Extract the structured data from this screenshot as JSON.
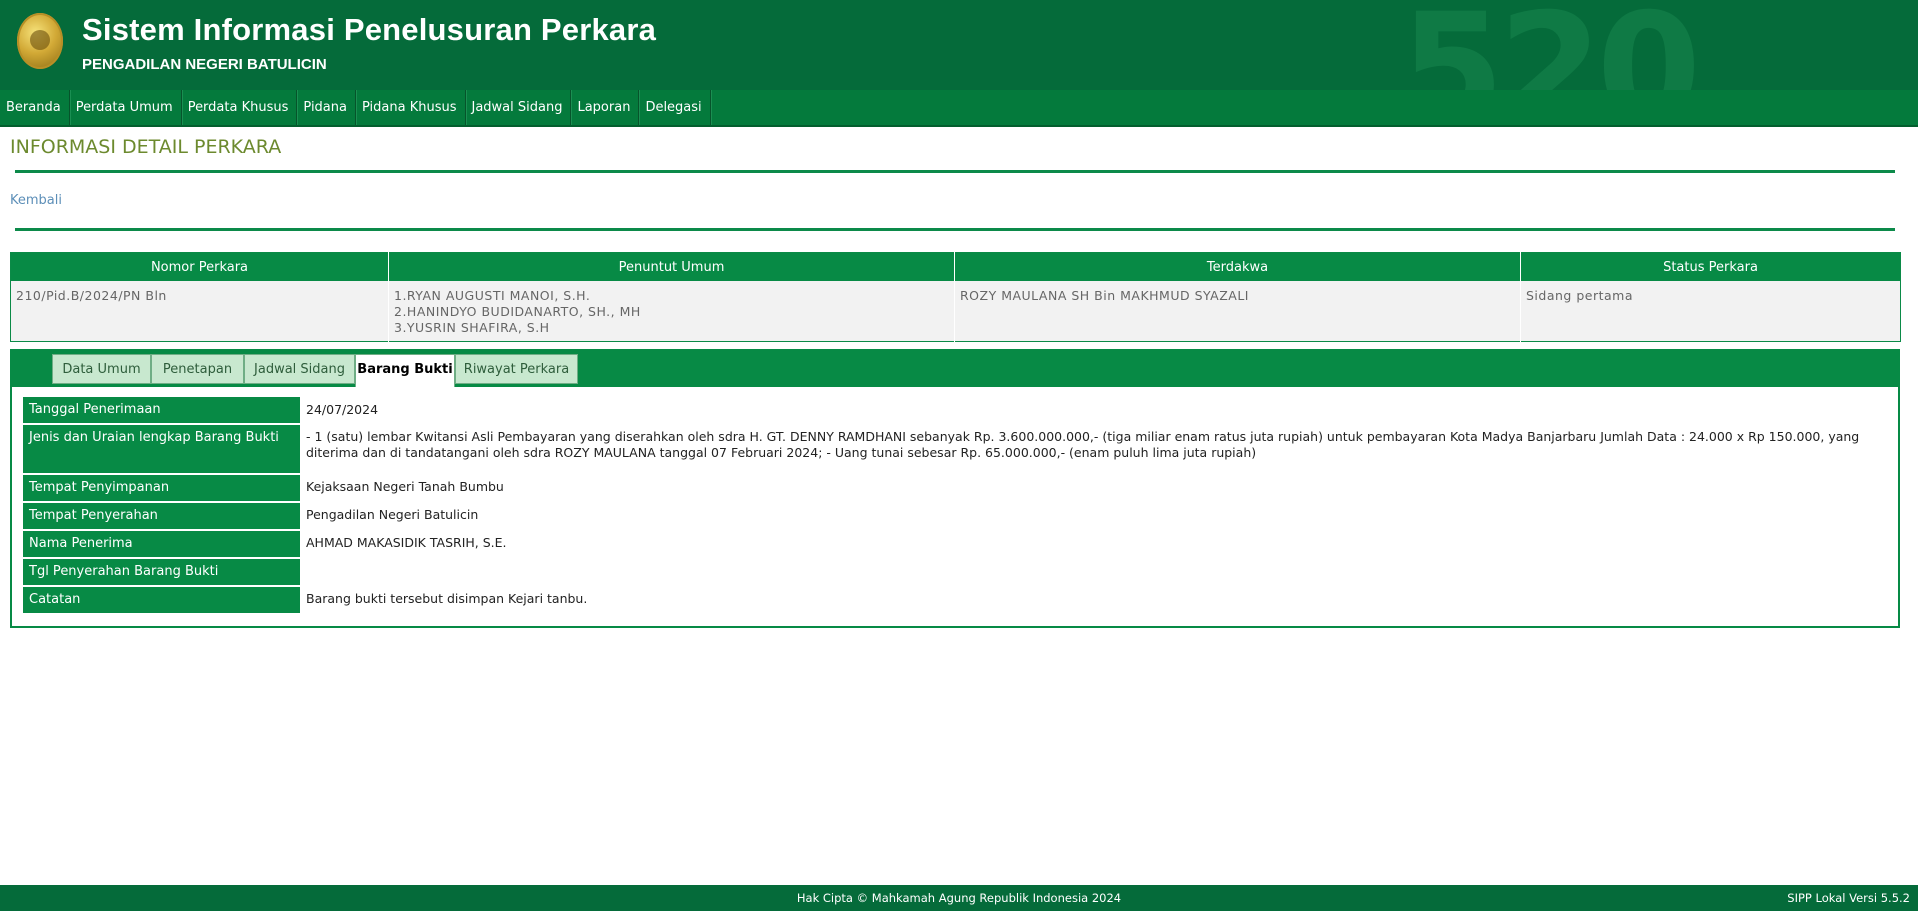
{
  "header": {
    "title": "Sistem Informasi Penelusuran Perkara",
    "subtitle": "PENGADILAN NEGERI BATULICIN",
    "watermark": "520"
  },
  "nav": {
    "items": [
      "Beranda",
      "Perdata Umum",
      "Perdata Khusus",
      "Pidana",
      "Pidana Khusus",
      "Jadwal Sidang",
      "Laporan",
      "Delegasi"
    ]
  },
  "page": {
    "heading": "INFORMASI DETAIL PERKARA",
    "back_link": "Kembali"
  },
  "summary": {
    "headers": [
      "Nomor Perkara",
      "Penuntut Umum",
      "Terdakwa",
      "Status Perkara"
    ],
    "nomor": "210/Pid.B/2024/PN Bln",
    "penuntut": [
      "1.RYAN AUGUSTI MANOI, S.H.",
      "2.HANINDYO BUDIDANARTO, SH., MH",
      "3.YUSRIN SHAFIRA, S.H"
    ],
    "terdakwa": "ROZY MAULANA SH Bin MAKHMUD SYAZALI",
    "status": "Sidang pertama"
  },
  "tabs": {
    "items": [
      "Data Umum",
      "Penetapan",
      "Jadwal Sidang",
      "Barang Bukti",
      "Riwayat Perkara"
    ],
    "active": "Barang Bukti"
  },
  "barang_bukti": {
    "rows": [
      {
        "label": "Tanggal Penerimaan",
        "value": "24/07/2024"
      },
      {
        "label": "Jenis dan Uraian lengkap Barang Bukti",
        "value": "- 1 (satu) lembar Kwitansi Asli Pembayaran yang diserahkan oleh sdra H. GT. DENNY RAMDHANI sebanyak Rp. 3.600.000.000,- (tiga miliar enam ratus juta rupiah) untuk pembayaran Kota Madya Banjarbaru Jumlah Data : 24.000 x Rp 150.000, yang diterima dan di tandatangani oleh sdra ROZY MAULANA tanggal 07 Februari 2024; - Uang tunai sebesar Rp. 65.000.000,- (enam puluh lima juta rupiah)"
      },
      {
        "label": "Tempat Penyimpanan",
        "value": "Kejaksaan Negeri Tanah Bumbu"
      },
      {
        "label": "Tempat Penyerahan",
        "value": "Pengadilan Negeri Batulicin"
      },
      {
        "label": "Nama Penerima",
        "value": "AHMAD MAKASIDIK TASRIH, S.E."
      },
      {
        "label": "Tgl Penyerahan Barang Bukti",
        "value": ""
      },
      {
        "label": "Catatan",
        "value": "Barang bukti tersebut disimpan Kejari tanbu."
      }
    ]
  },
  "footer": {
    "copyright": "Hak Cipta © Mahkamah Agung Republik Indonesia 2024",
    "version": "SIPP Lokal Versi 5.5.2"
  },
  "colors": {
    "primary_green": "#078a45",
    "header_green": "#056b3a",
    "heading_olive": "#6c8a2e",
    "link_blue": "#5d8fb8",
    "tab_inactive": "#c8e8cf"
  }
}
